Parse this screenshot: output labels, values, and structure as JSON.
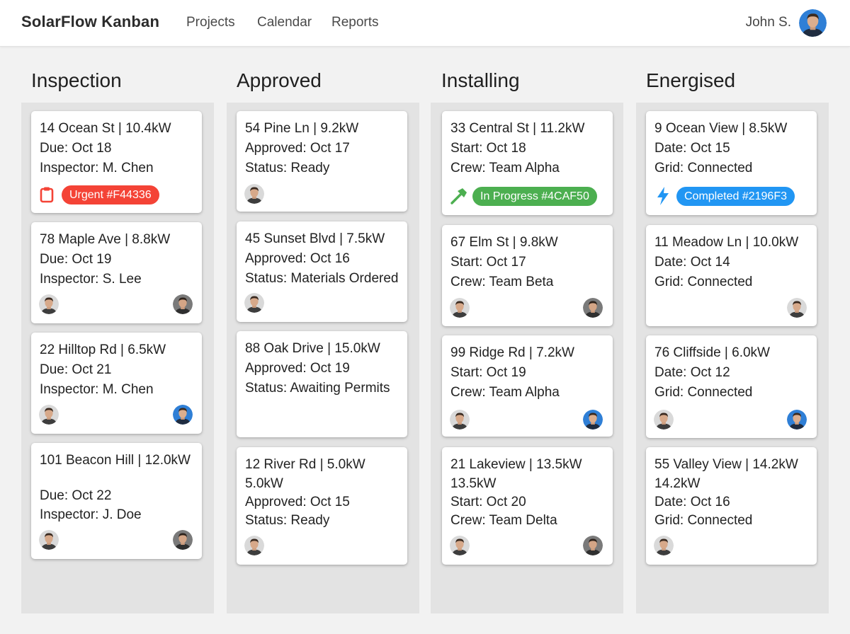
{
  "header": {
    "app_title": "SolarFlow Kanban",
    "nav": [
      "Projects",
      "Calendar",
      "Reports"
    ],
    "user_name": "John S."
  },
  "icons": {
    "urgent": "clipboard-icon",
    "in_progress": "hammer-icon",
    "completed": "lightning-bolt-icon"
  },
  "colors": {
    "urgent": "#F44336",
    "in_progress": "#4CAF50",
    "completed": "#2196F3"
  },
  "columns": [
    {
      "title": "Inspection",
      "cards": [
        {
          "lines": [
            "14 Ocean St | 10.4kW",
            "Due: Oct 18",
            "Inspector: M. Chen"
          ],
          "badge": "Urgent #F44336"
        },
        {
          "lines": [
            "78 Maple Ave | 8.8kW",
            "Due: Oct 19",
            "Inspector: S. Lee"
          ]
        },
        {
          "lines": [
            "22 Hilltop Rd | 6.5kW",
            "Due: Oct 21",
            "Inspector: M. Chen"
          ]
        },
        {
          "lines": [
            "101 Beacon Hill | 12.0kW",
            "Due: Oct 22",
            "Inspector: J. Doe"
          ]
        }
      ]
    },
    {
      "title": "Approved",
      "cards": [
        {
          "lines": [
            "54 Pine Ln | 9.2kW",
            "Approved: Oct 17",
            "Status: Ready"
          ]
        },
        {
          "lines": [
            "45 Sunset Blvd | 7.5kW",
            "Approved: Oct 16",
            "Status: Materials Ordered"
          ]
        },
        {
          "lines": [
            "88 Oak Drive | 15.0kW",
            "Approved: Oct 19",
            "Status: Awaiting Permits"
          ]
        },
        {
          "lines": [
            "12 River Rd | 5.0kW",
            "5.0kW",
            "Approved: Oct 15",
            "Status: Ready"
          ]
        }
      ]
    },
    {
      "title": "Installing",
      "cards": [
        {
          "lines": [
            "33 Central St | 11.2kW",
            "Start: Oct 18",
            "Crew: Team Alpha"
          ],
          "badge": "In Progress #4CAF50"
        },
        {
          "lines": [
            "67 Elm St | 9.8kW",
            "Start: Oct 17",
            "Crew: Team Beta"
          ]
        },
        {
          "lines": [
            "99 Ridge Rd | 7.2kW",
            "Start: Oct 19",
            "Crew: Team Alpha"
          ]
        },
        {
          "lines": [
            "21 Lakeview | 13.5kW",
            "13.5kW",
            "Start: Oct 20",
            "Crew: Team Delta"
          ]
        }
      ]
    },
    {
      "title": "Energised",
      "cards": [
        {
          "lines": [
            "9 Ocean View | 8.5kW",
            "Date: Oct 15",
            "Grid: Connected"
          ],
          "badge": "Completed #2196F3"
        },
        {
          "lines": [
            "11 Meadow Ln | 10.0kW",
            "Date: Oct 14",
            "Grid: Connected"
          ]
        },
        {
          "lines": [
            "76 Cliffside | 6.0kW",
            "Date: Oct 12",
            "Grid: Connected"
          ]
        },
        {
          "lines": [
            "55 Valley View | 14.2kW",
            "14.2kW",
            "Date: Oct 16",
            "Grid: Connected"
          ]
        }
      ]
    }
  ]
}
